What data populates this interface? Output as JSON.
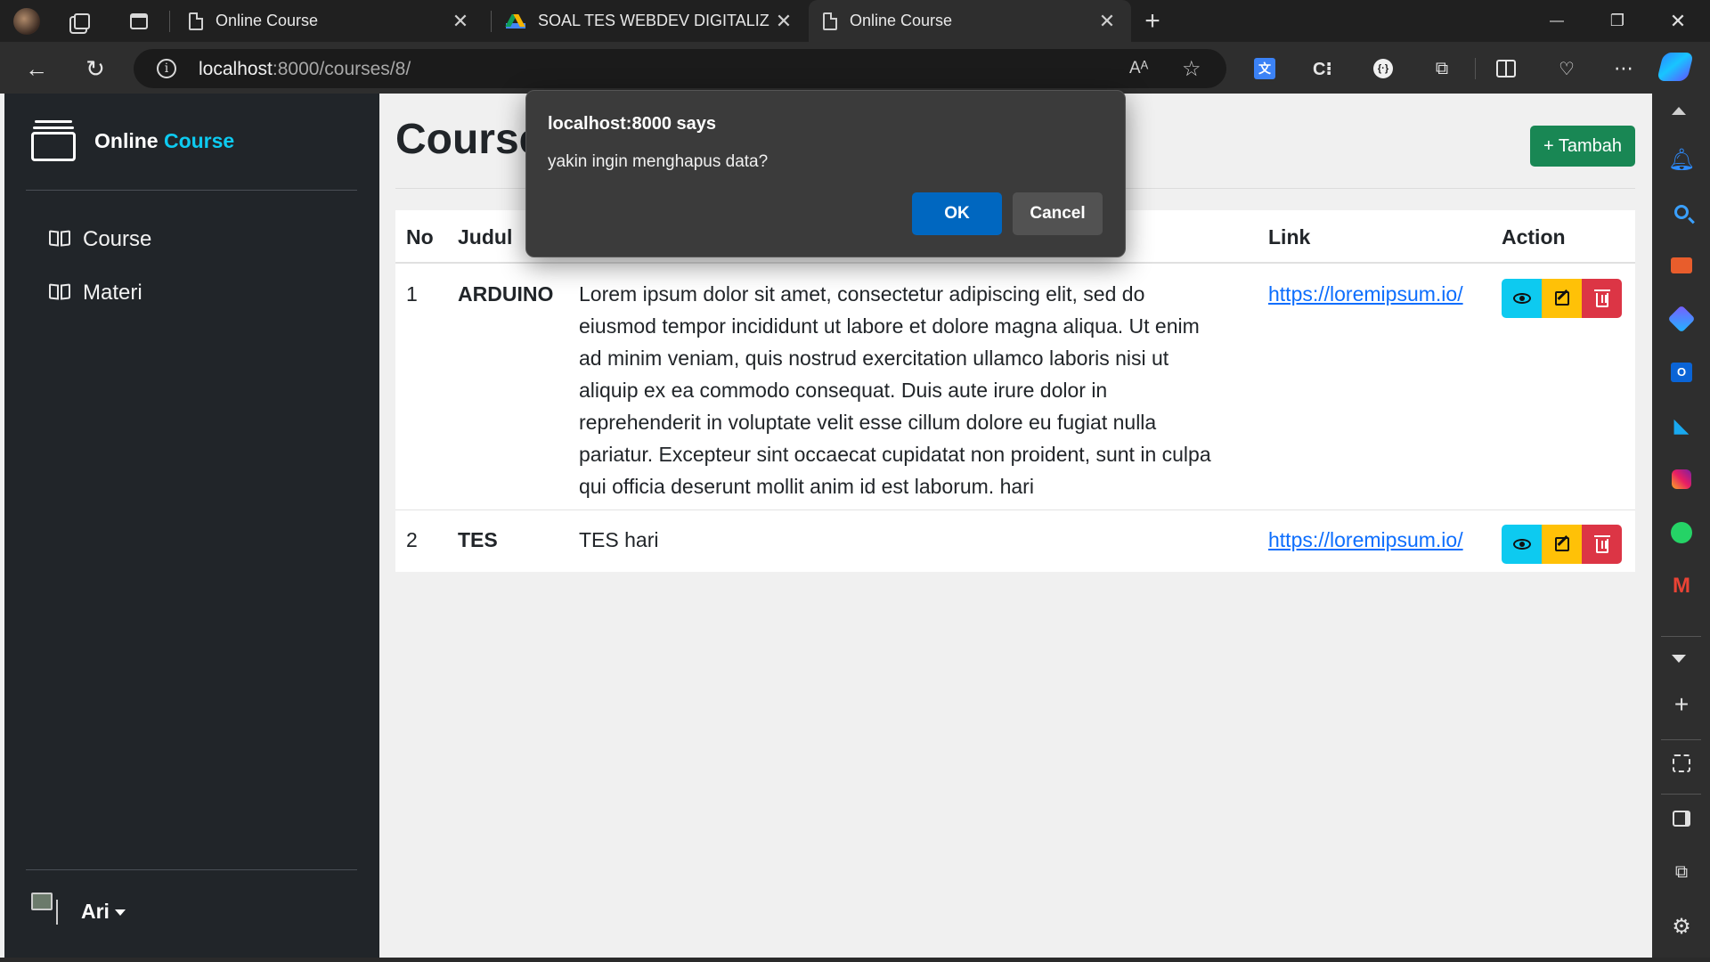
{
  "browser": {
    "tabs": [
      {
        "title": "Online Course",
        "close": "✕"
      },
      {
        "title": "SOAL TES WEBDEV DIGITALIZ BA",
        "close": "✕"
      },
      {
        "title": "Online Course",
        "close": "✕"
      }
    ],
    "new_tab": "+",
    "url_host": "localhost",
    "url_path": ":8000/courses/8/",
    "window_controls": {
      "minimize": "—",
      "restore": "❐",
      "close": "✕"
    }
  },
  "sidebar": {
    "brand_word1": "Online",
    "brand_word2": "Course",
    "brand_accent": "#0dcaf0",
    "items": [
      {
        "label": "Course",
        "icon": "book-icon"
      },
      {
        "label": "Materi",
        "icon": "book-icon"
      }
    ],
    "user": {
      "name": "Ari"
    }
  },
  "main": {
    "title": "Course",
    "add_button": "+ Tambah",
    "table": {
      "headers": [
        "No",
        "Judul",
        "Link",
        "Action"
      ],
      "rows": [
        {
          "no": "1",
          "judul": "ARDUINO",
          "desc_lines": [
            "Lorem ipsum dolor sit amet, consectetur adipiscing elit, sed do",
            "eiusmod tempor incididunt ut labore et dolore magna aliqua. Ut enim",
            "ad minim veniam, quis nostrud exercitation ullamco laboris nisi ut",
            "aliquip ex ea commodo consequat. Duis aute irure dolor in",
            "reprehenderit in voluptate velit esse cillum dolore eu fugiat nulla",
            "pariatur. Excepteur sint occaecat cupidatat non proident, sunt in culpa",
            "qui officia deserunt mollit anim id est laborum. hari"
          ],
          "link": "https://loremipsum.io/"
        },
        {
          "no": "2",
          "judul": "TES",
          "desc_lines": [
            "TES hari"
          ],
          "link": "https://loremipsum.io/"
        }
      ]
    }
  },
  "dialog": {
    "title": "localhost:8000 says",
    "message": "yakin ingin menghapus data?",
    "ok": "OK",
    "cancel": "Cancel"
  },
  "colors": {
    "sidebar_bg": "#212529",
    "add_button": "#198754",
    "view_button": "#0dcaf0",
    "edit_button": "#ffc107",
    "delete_button": "#dc3545",
    "dialog_ok": "#0067c0"
  }
}
